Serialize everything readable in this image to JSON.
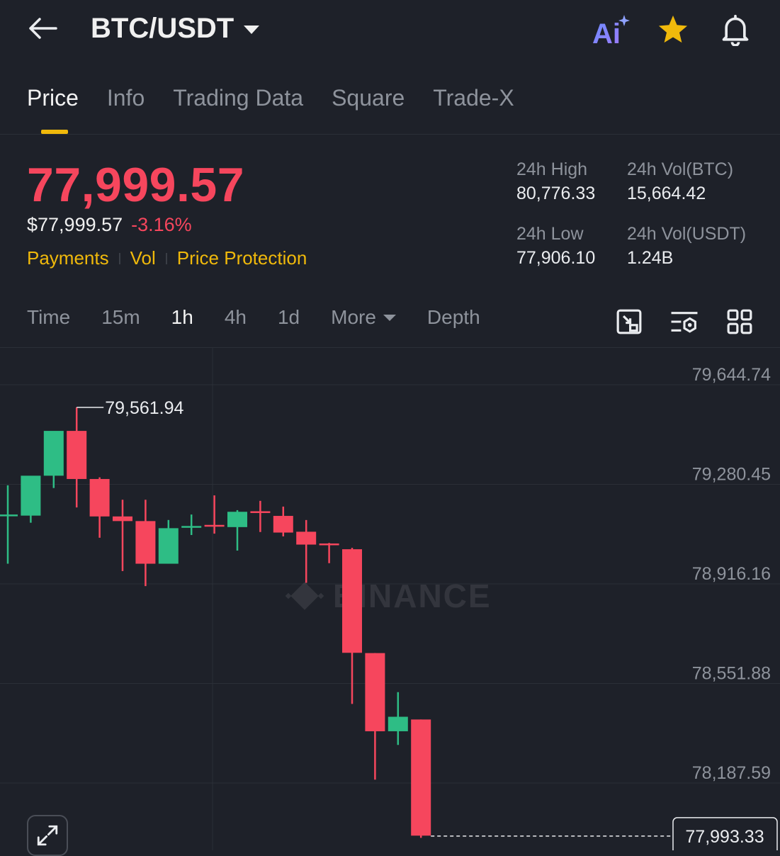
{
  "header": {
    "pair": "BTC/USDT",
    "icons": [
      "back-arrow-icon",
      "ai-icon",
      "star-icon",
      "bell-icon"
    ],
    "ai_label": "Ai"
  },
  "tabs": [
    {
      "label": "Price",
      "active": true
    },
    {
      "label": "Info"
    },
    {
      "label": "Trading Data"
    },
    {
      "label": "Square"
    },
    {
      "label": "Trade-X"
    }
  ],
  "ticker": {
    "last_price": "77,999.57",
    "usd_price": "$77,999.57",
    "change": "-3.16%",
    "links": [
      "Payments",
      "Vol",
      "Price Protection"
    ],
    "high_label": "24h High",
    "high": "80,776.33",
    "low_label": "24h Low",
    "low": "77,906.10",
    "vol_btc_label": "24h Vol(BTC)",
    "vol_btc": "15,664.42",
    "vol_usdt_label": "24h Vol(USDT)",
    "vol_usdt": "1.24B"
  },
  "timebar": {
    "items": [
      "Time",
      "15m",
      "1h",
      "4h",
      "1d"
    ],
    "active": "1h",
    "more": "More",
    "depth": "Depth",
    "tool_icons": [
      "crop-chart-icon",
      "indicator-settings-icon",
      "grid-layout-icon"
    ]
  },
  "chart_data": {
    "type": "candlestick",
    "interval": "1h",
    "watermark": "BINANCE",
    "y_ticks": [
      "79,644.74",
      "79,280.45",
      "78,916.16",
      "78,551.88",
      "78,187.59"
    ],
    "y_tick_values": [
      79644.74,
      79280.45,
      78916.16,
      78551.88,
      78187.59
    ],
    "high_marker": "79,561.94",
    "last_price_tag": "77,993.33",
    "last_price_value": 77993.33,
    "candles": [
      {
        "o": 79166,
        "h": 79277,
        "l": 78990,
        "c": 79170
      },
      {
        "o": 79166,
        "h": 79267,
        "l": 79140,
        "c": 79312
      },
      {
        "o": 79312,
        "h": 79402,
        "l": 79267,
        "c": 79476
      },
      {
        "o": 79476,
        "h": 79562,
        "l": 79196,
        "c": 79300
      },
      {
        "o": 79300,
        "h": 79306,
        "l": 79085,
        "c": 79163
      },
      {
        "o": 79163,
        "h": 79224,
        "l": 78963,
        "c": 79146
      },
      {
        "o": 79146,
        "h": 79224,
        "l": 78908,
        "c": 78990
      },
      {
        "o": 78990,
        "h": 79150,
        "l": 78990,
        "c": 79120
      },
      {
        "o": 79124,
        "h": 79170,
        "l": 79095,
        "c": 79128
      },
      {
        "o": 79132,
        "h": 79240,
        "l": 79100,
        "c": 79130
      },
      {
        "o": 79124,
        "h": 79186,
        "l": 79038,
        "c": 79180
      },
      {
        "o": 79182,
        "h": 79220,
        "l": 79106,
        "c": 79180
      },
      {
        "o": 79165,
        "h": 79199,
        "l": 79090,
        "c": 79104
      },
      {
        "o": 79107,
        "h": 79150,
        "l": 78920,
        "c": 79060
      },
      {
        "o": 79064,
        "h": 79066,
        "l": 78992,
        "c": 79060
      },
      {
        "o": 79043,
        "h": 79048,
        "l": 78477,
        "c": 78664
      },
      {
        "o": 78663,
        "h": 78663,
        "l": 78200,
        "c": 78377
      },
      {
        "o": 78377,
        "h": 78520,
        "l": 78327,
        "c": 78430
      },
      {
        "o": 78420,
        "h": 78420,
        "l": 77987,
        "c": 77995
      }
    ]
  }
}
